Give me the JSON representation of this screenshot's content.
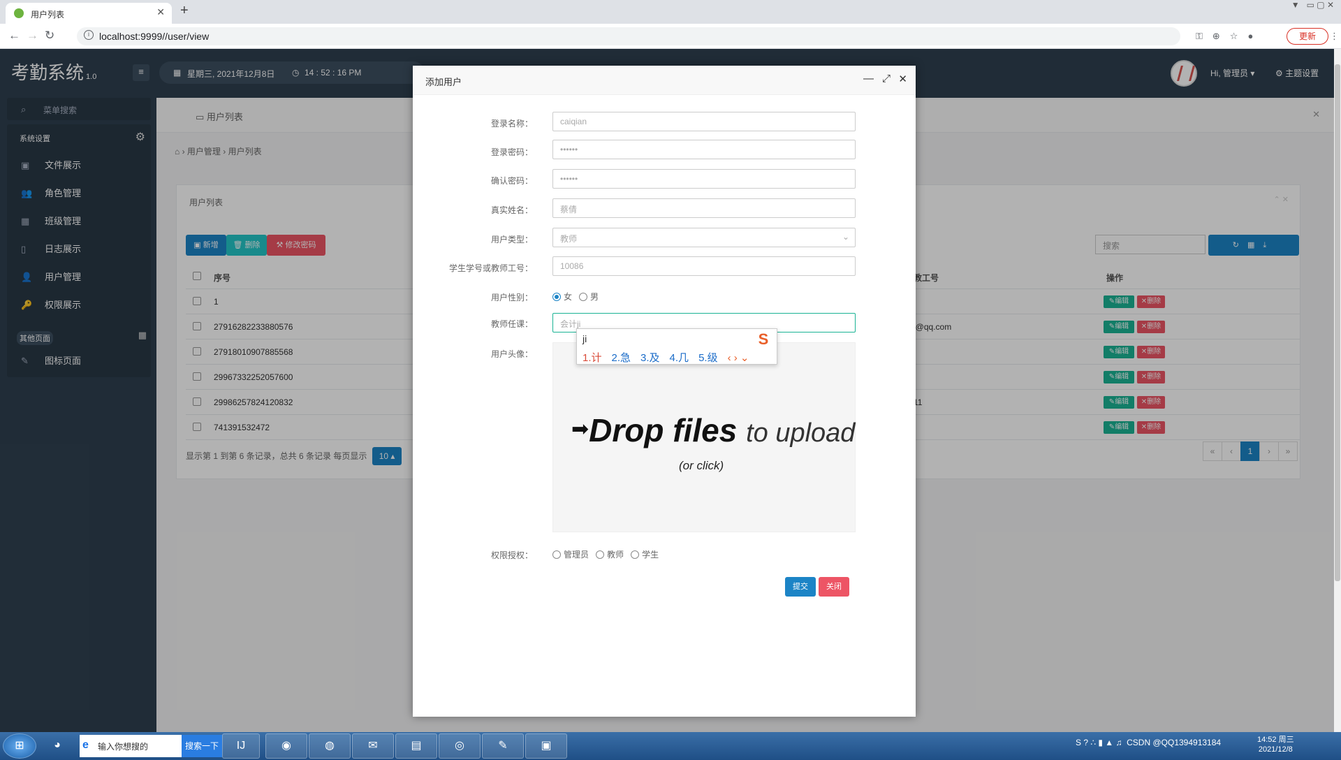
{
  "browser": {
    "tab_title": "用户列表",
    "url": "localhost:9999//user/view",
    "update_label": "更新"
  },
  "app": {
    "brand": "考勤系统",
    "version": "1.0",
    "date": "星期三, 2021年12月8日",
    "time": "14 : 52 : 16 PM",
    "user_greeting": "Hi, 管理员",
    "theme_label": "主题设置"
  },
  "sidebar": {
    "search_placeholder": "菜单搜索",
    "section1": "系统设置",
    "items": [
      {
        "label": "文件展示",
        "icon": "image-icon"
      },
      {
        "label": "角色管理",
        "icon": "users-icon"
      },
      {
        "label": "班级管理",
        "icon": "grid-icon"
      },
      {
        "label": "日志展示",
        "icon": "doc-icon"
      },
      {
        "label": "用户管理",
        "icon": "user-icon"
      },
      {
        "label": "权限展示",
        "icon": "key-icon"
      }
    ],
    "section2": "其他页面",
    "other_items": [
      {
        "label": "图标页面",
        "icon": "magic-icon"
      }
    ]
  },
  "page": {
    "tab_label": "用户列表",
    "breadcrumb": [
      "用户管理",
      "用户列表"
    ],
    "panel_title": "用户列表",
    "btn_add": "新增",
    "btn_delete": "删除",
    "btn_change_pwd": "修改密码",
    "search_placeholder": "搜索",
    "col_no": "序号",
    "col_teacher_no": "教工号",
    "col_ops": "操作",
    "edit_label": "编辑",
    "delete_label": "删除",
    "rows": [
      {
        "no": "1",
        "extra": ""
      },
      {
        "no": "27916282233880576",
        "extra": "l@qq.com"
      },
      {
        "no": "27918010907885568",
        "extra": ""
      },
      {
        "no": "29967332252057600",
        "extra": ""
      },
      {
        "no": "29986257824120832",
        "extra": "11"
      },
      {
        "no": "741391532472",
        "extra": ""
      }
    ],
    "footer": "显示第 1 到第 6 条记录，总共 6 条记录 每页显示",
    "page_size": "10",
    "current_page": "1"
  },
  "modal": {
    "title": "添加用户",
    "fields": {
      "login_name_label": "登录名称：",
      "login_name_placeholder": "caiqian",
      "password_label": "登录密码：",
      "password_placeholder": "••••••",
      "confirm_label": "确认密码：",
      "confirm_placeholder": "••••••",
      "realname_label": "真实姓名：",
      "realname_placeholder": "蔡倩",
      "usertype_label": "用户类型：",
      "usertype_value": "教师",
      "number_label": "学生学号或教师工号：",
      "number_placeholder": "10086",
      "gender_label": "用户性别：",
      "gender_female": "女",
      "gender_male": "男",
      "teach_label": "教师任课：",
      "teach_value": "会计ji",
      "avatar_label": "用户头像：",
      "perm_label": "权限授权：",
      "perm_admin": "管理员",
      "perm_teacher": "教师",
      "perm_student": "学生"
    },
    "dropzone_main": "Drop files",
    "dropzone_sub": "to upload",
    "dropzone_click": "(or click)",
    "submit_label": "提交",
    "close_label": "关闭"
  },
  "ime": {
    "pinyin": "ji",
    "candidates": [
      "1.计",
      "2.急",
      "3.及",
      "4.几",
      "5.级"
    ]
  },
  "taskbar": {
    "search_text": "输入你想搜的",
    "search_button": "搜索一下",
    "clock_time": "14:52 周三",
    "clock_date": "2021/12/8",
    "watermark": "CSDN @QQ1394913184"
  }
}
